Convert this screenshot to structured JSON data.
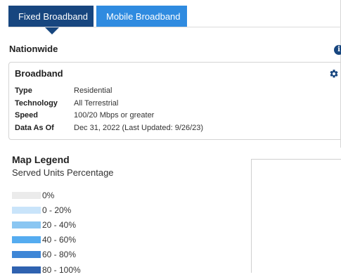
{
  "tabs": [
    {
      "label": "Fixed Broadband",
      "active": true
    },
    {
      "label": "Mobile Broadband",
      "active": false
    }
  ],
  "section_title": "Nationwide",
  "card": {
    "title": "Broadband",
    "rows": [
      {
        "key": "Type",
        "value": "Residential"
      },
      {
        "key": "Technology",
        "value": "All Terrestrial"
      },
      {
        "key": "Speed",
        "value": "100/20 Mbps or greater"
      },
      {
        "key": "Data As Of",
        "value": "Dec 31, 2022 (Last Updated: 9/26/23)"
      }
    ]
  },
  "legend": {
    "title": "Map Legend",
    "subtitle": "Served Units Percentage",
    "items": [
      {
        "label": "0%",
        "color": "#ebebeb"
      },
      {
        "label": "0 - 20%",
        "color": "#c9e4fa"
      },
      {
        "label": "20 - 40%",
        "color": "#8ac6f2"
      },
      {
        "label": "40 - 60%",
        "color": "#55acf0"
      },
      {
        "label": "60 - 80%",
        "color": "#3e86d6"
      },
      {
        "label": "80 - 100%",
        "color": "#2f62b0"
      }
    ]
  },
  "colors": {
    "active_tab": "#17467f",
    "inactive_tab": "#2f8be0"
  }
}
